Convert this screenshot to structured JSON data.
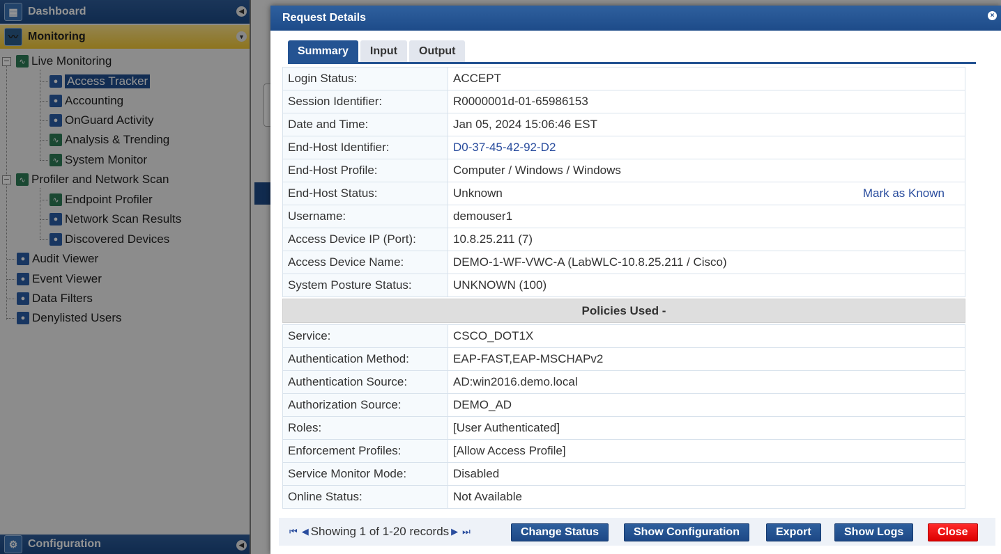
{
  "nav": {
    "dashboard": "Dashboard",
    "monitoring": "Monitoring",
    "configuration": "Configuration",
    "live_monitoring": "Live Monitoring",
    "live_items": [
      "Access Tracker",
      "Accounting",
      "OnGuard Activity",
      "Analysis & Trending",
      "System Monitor"
    ],
    "profiler": "Profiler and Network Scan",
    "profiler_items": [
      "Endpoint Profiler",
      "Network Scan Results",
      "Discovered Devices"
    ],
    "other_items": [
      "Audit Viewer",
      "Event Viewer",
      "Data Filters",
      "Denylisted Users"
    ]
  },
  "modal": {
    "title": "Request Details",
    "tabs": [
      "Summary",
      "Input",
      "Output"
    ],
    "active_tab": "Summary",
    "summary_rows": [
      {
        "label": "Login Status:",
        "value": "ACCEPT"
      },
      {
        "label": "Session Identifier:",
        "value": "R0000001d-01-65986153"
      },
      {
        "label": "Date and Time:",
        "value": "Jan 05, 2024 15:06:46 EST"
      },
      {
        "label": "End-Host Identifier:",
        "value": "D0-37-45-42-92-D2"
      },
      {
        "label": "End-Host Profile:",
        "value": "Computer / Windows / Windows"
      },
      {
        "label": "End-Host Status:",
        "value": "Unknown",
        "action": "Mark as Known"
      },
      {
        "label": "Username:",
        "value": "demouser1"
      },
      {
        "label": "Access Device IP (Port):",
        "value": "10.8.25.211 (7)"
      },
      {
        "label": "Access Device Name:",
        "value": "DEMO-1-WF-VWC-A (LabWLC-10.8.25.211 / Cisco)"
      },
      {
        "label": "System Posture Status:",
        "value": "UNKNOWN (100)"
      }
    ],
    "policies_header": "Policies Used -",
    "policy_rows": [
      {
        "label": "Service:",
        "value": "CSCO_DOT1X"
      },
      {
        "label": "Authentication Method:",
        "value": "EAP-FAST,EAP-MSCHAPv2"
      },
      {
        "label": "Authentication Source:",
        "value": "AD:win2016.demo.local"
      },
      {
        "label": "Authorization Source:",
        "value": "DEMO_AD"
      },
      {
        "label": "Roles:",
        "value": "[User Authenticated]"
      },
      {
        "label": "Enforcement Profiles:",
        "value": "[Allow Access Profile]"
      },
      {
        "label": "Service Monitor Mode:",
        "value": "Disabled"
      },
      {
        "label": "Online Status:",
        "value": "Not Available"
      }
    ],
    "pager_text": "Showing 1 of 1-20 records",
    "buttons": {
      "change_status": "Change Status",
      "show_configuration": "Show Configuration",
      "export": "Export",
      "show_logs": "Show Logs",
      "close": "Close"
    }
  },
  "colors": {
    "accent": "#245392",
    "close_button": "#e00000",
    "highlight": "#f3c935"
  }
}
